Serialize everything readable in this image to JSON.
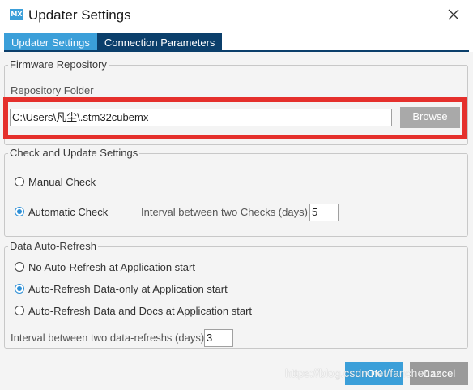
{
  "window": {
    "title": "Updater Settings",
    "icon_text": "MX"
  },
  "tabs": [
    {
      "label": "Updater Settings",
      "active": true
    },
    {
      "label": "Connection Parameters",
      "active": false
    }
  ],
  "firmware_repository": {
    "legend": "Firmware Repository",
    "folder_label": "Repository Folder",
    "folder_value": "C:\\Users\\凡尘\\.stm32cubemx",
    "browse_label": "Browse"
  },
  "check_settings": {
    "legend": "Check and Update Settings",
    "manual_label": "Manual Check",
    "automatic_label": "Automatic Check",
    "selected": "automatic",
    "interval_label": "Interval between two Checks (days)",
    "interval_value": "5"
  },
  "data_refresh": {
    "legend": "Data Auto-Refresh",
    "options": [
      {
        "label": "No Auto-Refresh at Application start",
        "selected": false
      },
      {
        "label": "Auto-Refresh Data-only at Application start",
        "selected": true
      },
      {
        "label": "Auto-Refresh Data and Docs at Application start",
        "selected": false
      }
    ],
    "interval_label": "Interval between two data-refreshs (days)",
    "interval_value": "3"
  },
  "buttons": {
    "ok": "OK",
    "cancel": "Cancel"
  },
  "watermark": "https://blog.csdn.net/fanchenzz",
  "colors": {
    "accent": "#3b9fd9",
    "tab_dark": "#0b3f6b",
    "highlight": "#e5302c"
  }
}
